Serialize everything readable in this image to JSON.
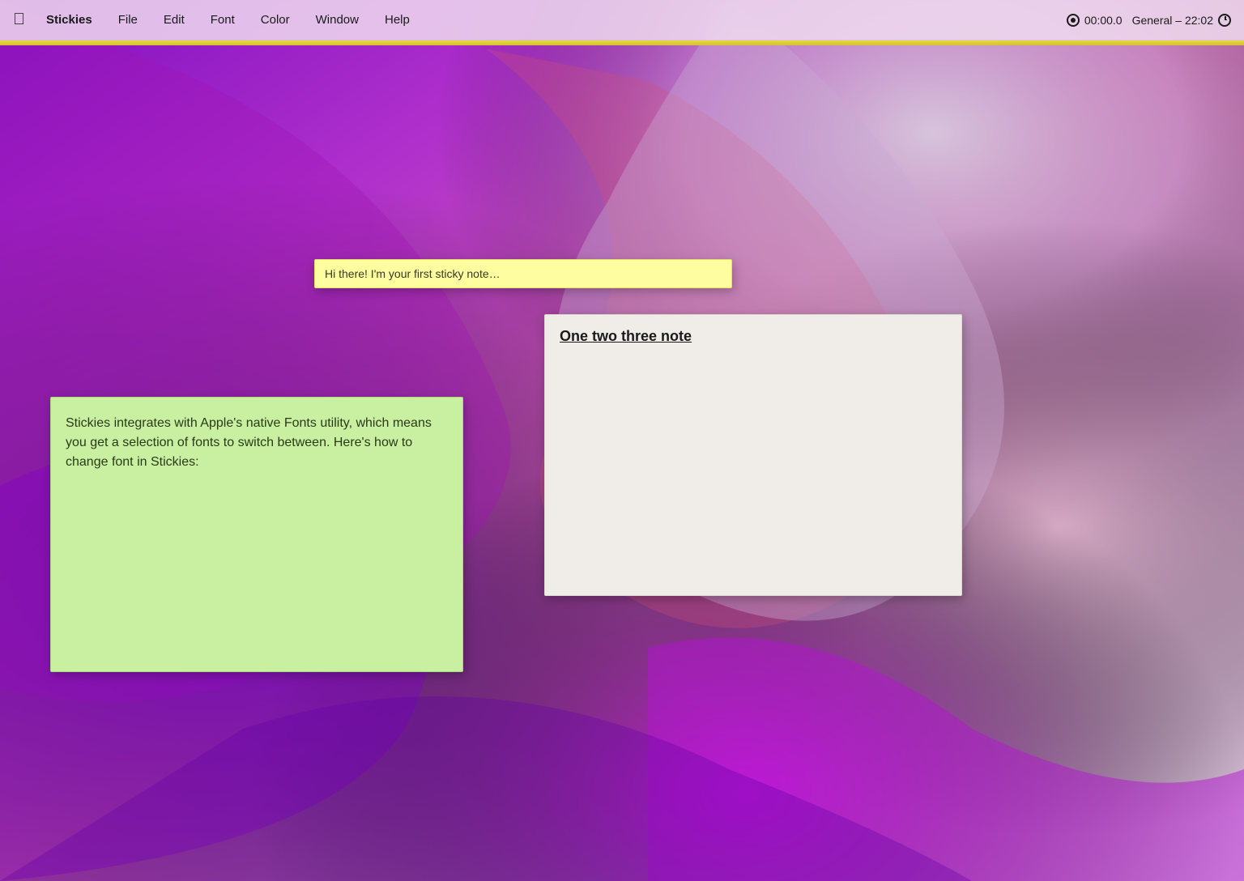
{
  "menubar": {
    "apple_label": "",
    "app_name": "Stickies",
    "items": [
      {
        "label": "File"
      },
      {
        "label": "Edit"
      },
      {
        "label": "Font"
      },
      {
        "label": "Color"
      },
      {
        "label": "Window"
      },
      {
        "label": "Help"
      }
    ],
    "timer": "00:00.0",
    "clock": "General – 22:02"
  },
  "sticky_notes": {
    "yellow": {
      "text": "Hi there! I'm your first sticky note…"
    },
    "green": {
      "text": "Stickies integrates with Apple's native Fonts utility, which means you get a selection of fonts to switch between. Here's how to change font in Stickies:"
    },
    "white": {
      "title": "One two three note",
      "text": ""
    }
  }
}
